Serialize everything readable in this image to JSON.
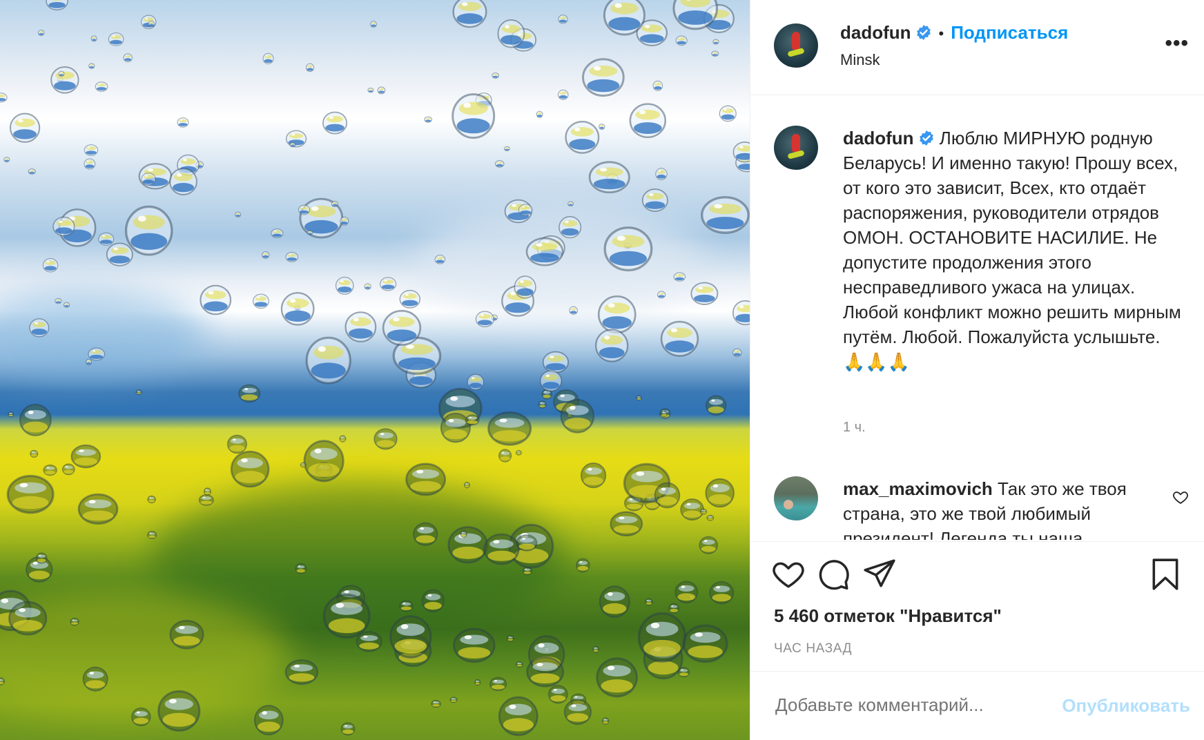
{
  "post": {
    "author": "dadofun",
    "follow_label": "Подписаться",
    "separator": "•",
    "location": "Minsk",
    "more_label": "•••",
    "caption_author": "dadofun",
    "caption_text": "Люблю МИРНУЮ родную Беларусь! И именно такую! Прошу всех, от кого это зависит, Всех, кто отдаёт распоряжения, руководители отрядов ОМОН. ОСТАНОВИТЕ НАСИЛИЕ. Не допустите продолжения этого несправедливого ужаса на улицах. Любой конфликт можно решить мирным путём. Любой. Пожалуйста услышьте.",
    "caption_emoji": "🙏🙏🙏",
    "caption_time": "1 ч.",
    "comment": {
      "author": "max_maximovich",
      "text": "Так это же твоя страна, это же твой любимый президент! Легенда ты наша"
    },
    "likes": "5 460 отметок \"Нравится\"",
    "posted": "ЧАС НАЗАД",
    "comment_placeholder": "Добавьте комментарий...",
    "publish_label": "Опубликовать"
  },
  "colors": {
    "link_blue": "#0095f6",
    "publish_disabled": "#b2dffc",
    "muted": "#8e8e8e",
    "text": "#262626",
    "verified": "#3897f0"
  },
  "icons": {
    "verified": "verified-badge-icon",
    "like": "heart-icon",
    "comment": "comment-bubble-icon",
    "share": "paper-plane-icon",
    "save": "bookmark-icon",
    "comment_like": "small-heart-icon",
    "more": "more-options-icon"
  }
}
